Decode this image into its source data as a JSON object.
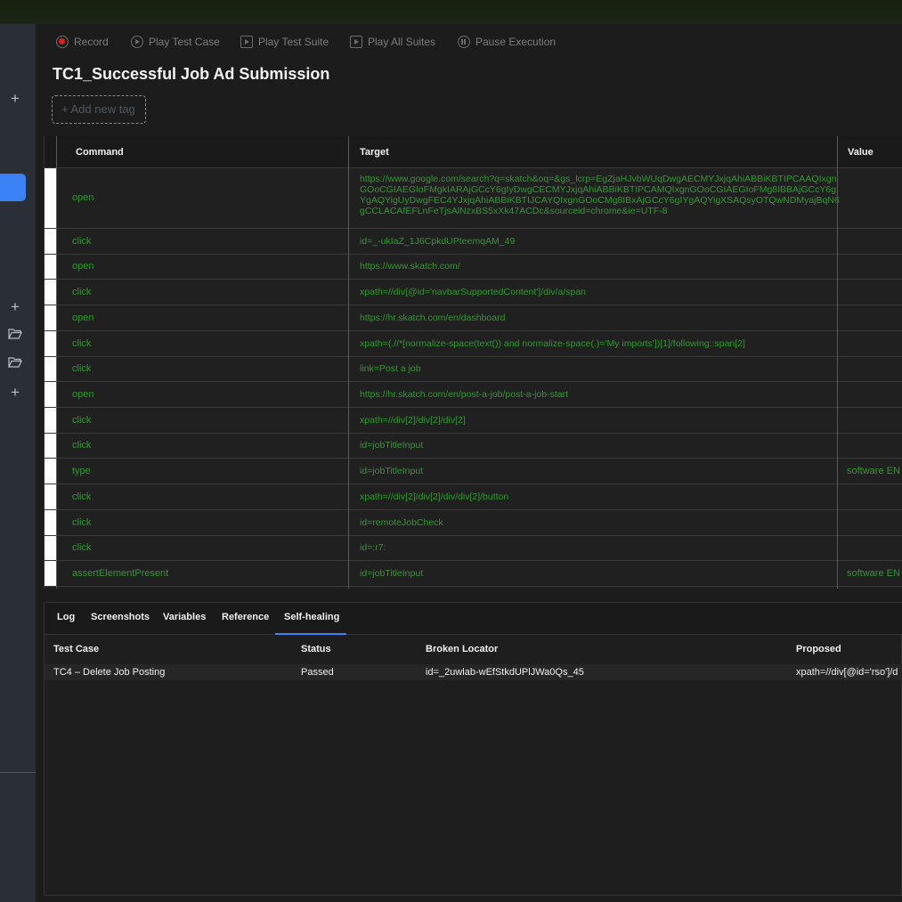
{
  "toolbar": {
    "record": "Record",
    "play_test_case": "Play Test Case",
    "play_test_suite": "Play Test Suite",
    "play_all_suites": "Play All Suites",
    "pause_execution": "Pause Execution"
  },
  "test_case": {
    "title": "TC1_Successful Job Ad Submission",
    "add_tag": "+ Add new tag"
  },
  "grid": {
    "headers": {
      "command": "Command",
      "target": "Target",
      "value": "Value"
    },
    "rows": [
      {
        "command": "open",
        "target": "https://www.google.com/search?q=skatch&oq=&gs_lcrp=EgZjaHJvbWUqDwgAECMYJxjqAhiABBiKBTIPCAAQIxgnGOoCGIAEGIoFMgkIARAjGCcY6gIyDwgCECMYJxjqAhiABBiKBTIPCAMQIxgnGOoCGIAEGIoFMg8IBBAjGCcY6gIYgAQYigUyDwgFEC4YJxjqAhiABBiKBTIJCAYQIxgnGOoCMg8IBxAjGCcY6gIYgAQYigXSAQsyOTQwNDMyajBqN6gCCLACAfEFLnFeTjsAlNzxBS5xXk47ACDc&sourceid=chrome&ie=UTF-8",
        "value": ""
      },
      {
        "command": "click",
        "target": "id=_-ukIaZ_1J6CpkdUPteemqAM_49",
        "value": ""
      },
      {
        "command": "open",
        "target": "https://www.skatch.com/",
        "value": ""
      },
      {
        "command": "click",
        "target": "xpath=//div[@id='navbarSupportedContent']/div/a/span",
        "value": ""
      },
      {
        "command": "open",
        "target": "https://hr.skatch.com/en/dashboard",
        "value": ""
      },
      {
        "command": "click",
        "target": "xpath=(.//*[normalize-space(text()) and normalize-space(.)='My imports'])[1]/following::span[2]",
        "value": ""
      },
      {
        "command": "click",
        "target": "link=Post a job",
        "value": ""
      },
      {
        "command": "open",
        "target": "https://hr.skatch.com/en/post-a-job/post-a-job-start",
        "value": ""
      },
      {
        "command": "click",
        "target": "xpath=//div[2]/div[2]/div[2]",
        "value": ""
      },
      {
        "command": "click",
        "target": "id=jobTitleInput",
        "value": ""
      },
      {
        "command": "type",
        "target": "id=jobTitleInput",
        "value": "software EN"
      },
      {
        "command": "click",
        "target": "xpath=//div[2]/div[2]/div/div[2]/button",
        "value": ""
      },
      {
        "command": "click",
        "target": "id=remoteJobCheck",
        "value": ""
      },
      {
        "command": "click",
        "target": "id=:r7:",
        "value": ""
      },
      {
        "command": "assertElementPresent",
        "target": "id=jobTitleInput",
        "value": "software EN"
      }
    ]
  },
  "bottom_tabs": [
    "Log",
    "Screenshots",
    "Variables",
    "Reference",
    "Self-healing"
  ],
  "self_healing": {
    "headers": {
      "test_case": "Test Case",
      "status": "Status",
      "broken_locator": "Broken Locator",
      "proposed": "Proposed"
    },
    "rows": [
      {
        "test_case": "TC4 – Delete Job Posting",
        "status": "Passed",
        "broken_locator": "id=_2uwlab-wEfStkdUPlJWa0Qs_45",
        "proposed": "xpath=//div[@id='rso']/d"
      }
    ]
  },
  "icons": {
    "sidebar": [
      "plus-icon",
      "plus-icon",
      "folder-open-icon",
      "folder-open-icon",
      "plus-icon"
    ]
  },
  "colors": {
    "accent": "#3b82f6",
    "record": "#e21b1b",
    "command_text": "#2e9b2e"
  }
}
